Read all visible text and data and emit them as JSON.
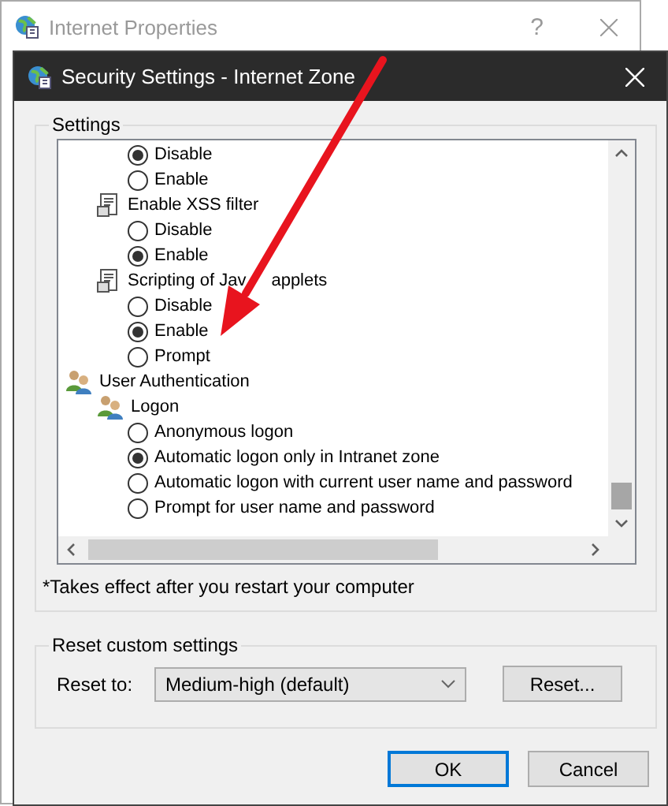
{
  "background_window": {
    "title": "Internet Properties",
    "help": "?"
  },
  "dialog": {
    "title": "Security Settings - Internet Zone"
  },
  "settings": {
    "label": "Settings",
    "tree": [
      {
        "kind": "group",
        "children": [
          {
            "kind": "setting",
            "children": [
              {
                "kind": "radio",
                "label": "Disable",
                "selected": true
              },
              {
                "kind": "radio",
                "label": "Enable",
                "selected": false
              }
            ]
          },
          {
            "kind": "setting",
            "label": "Enable XSS filter",
            "children": [
              {
                "kind": "radio",
                "label": "Disable",
                "selected": false
              },
              {
                "kind": "radio",
                "label": "Enable",
                "selected": true
              }
            ]
          },
          {
            "kind": "setting",
            "label_parts": [
              "Scripting of Jav",
              "applets"
            ],
            "children": [
              {
                "kind": "radio",
                "label": "Disable",
                "selected": false
              },
              {
                "kind": "radio",
                "label": "Enable",
                "selected": true
              },
              {
                "kind": "radio",
                "label": "Prompt",
                "selected": false
              }
            ]
          }
        ]
      },
      {
        "kind": "group",
        "label": "User Authentication",
        "children": [
          {
            "kind": "subgroup",
            "label": "Logon",
            "children": [
              {
                "kind": "radio",
                "label": "Anonymous logon",
                "selected": false
              },
              {
                "kind": "radio",
                "label": "Automatic logon only in Intranet zone",
                "selected": true
              },
              {
                "kind": "radio",
                "label": "Automatic logon with current user name and password",
                "selected": false
              },
              {
                "kind": "radio",
                "label": "Prompt for user name and password",
                "selected": false
              }
            ]
          }
        ]
      }
    ],
    "note": "*Takes effect after you restart your computer"
  },
  "reset": {
    "label": "Reset custom settings",
    "field_label": "Reset to:",
    "value": "Medium-high (default)",
    "button": "Reset..."
  },
  "buttons": [
    {
      "label": "OK",
      "default": true
    },
    {
      "label": "Cancel",
      "default": false
    }
  ]
}
